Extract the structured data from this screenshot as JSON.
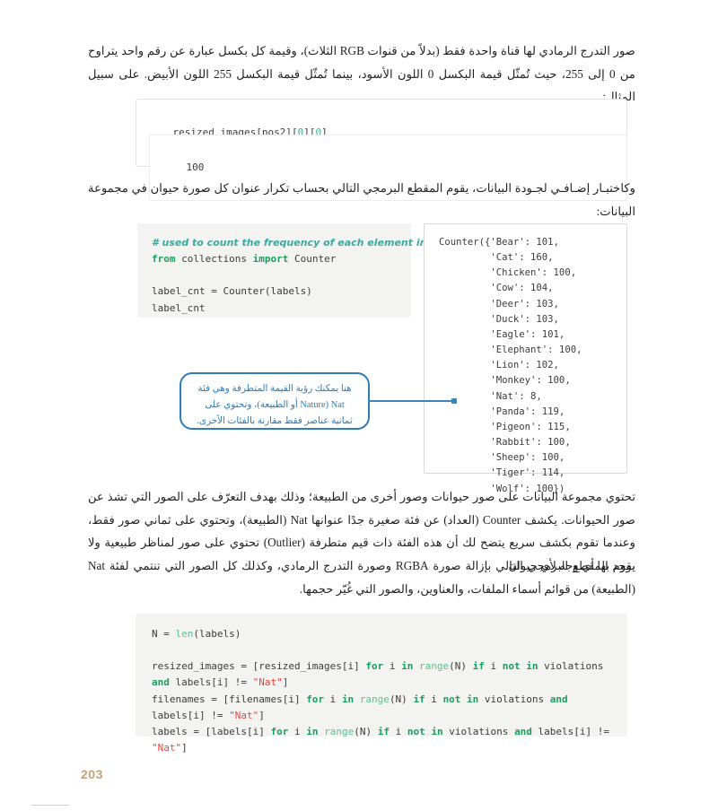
{
  "page": {
    "number": "203",
    "language": "ar"
  },
  "paragraphs": {
    "intro": "صور التدرج الرمادي لها قناة واحدة فقط (بدلاً من قنوات RGB الثلاث)، وقيمة كل بكسل عبارة عن رقم واحد يتراوح من 0 إلى 255، حيث تُمثّل قيمة البكسل 0 اللون الأسود، بينما تُمثّل قيمة البكسل 255 اللون الأبيض. على سبيل المثال:",
    "counter_intro": "وكاختبـار إضـافـي لجـودة البيانات، يقوم المقطع البرمجي التالي بحساب تكرار عنوان كل صورة حيوان في مجموعة البيانات:",
    "explain_1": "تحتوي مجموعة البيانات على صور حيوانات وصور أخرى من الطبيعة؛ وذلك بهدف التعرّف على الصور التي تشذ عن صور الحيوانات. يكشف Counter (العداد) عن فئة صغيرة جدًا عنوانها Nat (الطبيعة)، وتحتوي على ثماني صور فقط، وعندما تقوم بكشف سريع يتضح لك أن هذه الفئة ذات قيم متطرفة (Outlier) تحتوي على صور لمناظر طبيعية ولا يوجد بها أي وجه لأي حيوان.",
    "explain_2": "يقوم المقطع البرمجي التالي بإزالة صورة RGBA وصورة التدرج الرمادي، وكذلك كل الصور التي تنتمي لفئة Nat (الطبيعة) من قوائم أسماء الملفات، والعناوين، والصور التي غُيّر حجمها."
  },
  "cells": {
    "cell1_input": "resized_images[pos2][0][0]",
    "cell1_output": "100",
    "cell2_code": {
      "comment": "# used to count the frequency of each element in a list.",
      "line_import_kw1": "from",
      "line_import_mod": " collections ",
      "line_import_kw2": "import",
      "line_import_name": " Counter",
      "line_assign": "label_cnt = Counter(labels)",
      "line_echo": "label_cnt"
    },
    "counter_output": {
      "prefix": "Counter({",
      "entries": [
        {
          "key": "'Bear'",
          "value": "101"
        },
        {
          "key": "'Cat'",
          "value": "160"
        },
        {
          "key": "'Chicken'",
          "value": "100"
        },
        {
          "key": "'Cow'",
          "value": "104"
        },
        {
          "key": "'Deer'",
          "value": "103"
        },
        {
          "key": "'Duck'",
          "value": "103"
        },
        {
          "key": "'Eagle'",
          "value": "101"
        },
        {
          "key": "'Elephant'",
          "value": "100"
        },
        {
          "key": "'Lion'",
          "value": "102"
        },
        {
          "key": "'Monkey'",
          "value": "100"
        },
        {
          "key": "'Nat'",
          "value": "8"
        },
        {
          "key": "'Panda'",
          "value": "119"
        },
        {
          "key": "'Pigeon'",
          "value": "115"
        },
        {
          "key": "'Rabbit'",
          "value": "100"
        },
        {
          "key": "'Sheep'",
          "value": "100"
        },
        {
          "key": "'Tiger'",
          "value": "114"
        },
        {
          "key": "'Wolf'",
          "value": "100"
        }
      ],
      "suffix": "})",
      "full_text": "Counter({'Bear': 101,\n         'Cat': 160,\n         'Chicken': 100,\n         'Cow': 104,\n         'Deer': 103,\n         'Duck': 103,\n         'Eagle': 101,\n         'Elephant': 100,\n         'Lion': 102,\n         'Monkey': 100,\n         'Nat': 8,\n         'Panda': 119,\n         'Pigeon': 115,\n         'Rabbit': 100,\n         'Sheep': 100,\n         'Tiger': 114,\n         'Wolf': 100})"
    },
    "cell3_code": {
      "l1": "N = len(labels)",
      "l2": "",
      "l3": "resized_images = [resized_images[i] for i in range(N) if i not in violations",
      "l4": "and labels[i] != \"Nat\"]",
      "l5": "filenames = [filenames[i] for i in range(N) if i not in violations and",
      "l6": "labels[i] != \"Nat\"]",
      "l7": "labels = [labels[i] for i in range(N) if i not in violations and labels[i] !=",
      "l8": "\"Nat\"]"
    }
  },
  "callout": {
    "line1": "هنا يمكنك رؤية القيمة المتطرفة وهي فئة",
    "line2": "Nat (Nature أو الطبيعة)، وتحتوي على",
    "line3": "ثمانية عناصر فقط مقارنة بالفئات الأخرى.",
    "color": "#2e7cb8"
  },
  "colors": {
    "page_number": "#c2a179",
    "callout_border": "#2e7cb8",
    "connector": "#3a84bd",
    "code_bg_gray": "#f3f3f2",
    "keyword_green": "#1a9e5e",
    "string_red": "#e8453c",
    "comment_teal": "#3aa99f",
    "builtin_green": "#5dbf8f",
    "number_teal": "#3bb08f"
  }
}
